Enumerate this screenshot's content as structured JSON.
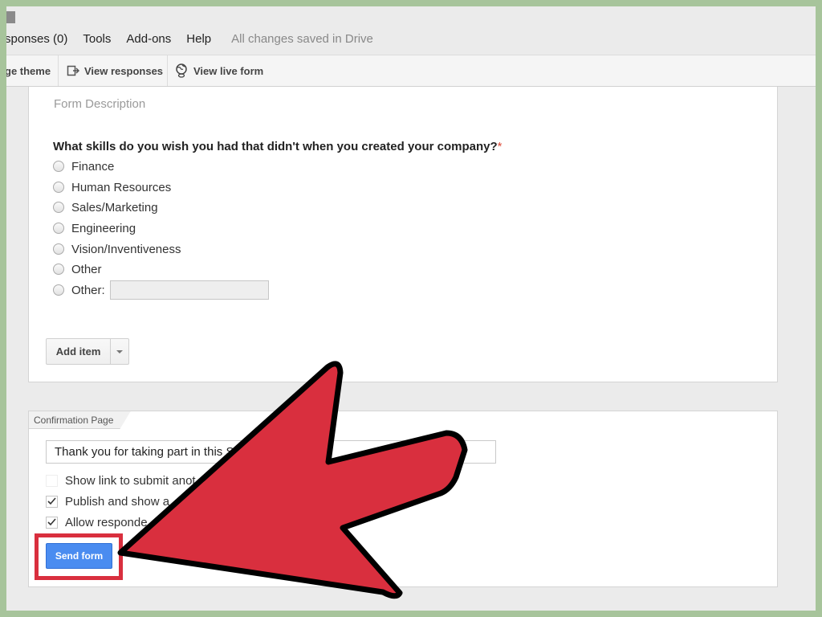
{
  "menubar": {
    "responses": "sponses (0)",
    "tools": "Tools",
    "addons": "Add-ons",
    "help": "Help",
    "save_status": "All changes saved in Drive"
  },
  "toolbar": {
    "change_theme": "ge theme",
    "view_responses": "View responses",
    "view_live_form": "View live form"
  },
  "form": {
    "description_placeholder": "Form Description",
    "question": "What skills do you wish you had that didn't when you created your company?",
    "required_marker": "*",
    "options": [
      "Finance",
      "Human Resources",
      "Sales/Marketing",
      "Engineering",
      "Vision/Inventiveness",
      "Other",
      "Other:"
    ],
    "add_item": "Add item"
  },
  "confirmation": {
    "tab_label": "Confirmation Page",
    "message": "Thank you for taking part in this S",
    "checkboxes": [
      {
        "label": "Show link to submit anot",
        "checked": false
      },
      {
        "label": "Publish and show a",
        "checked": true
      },
      {
        "label": "Allow responde",
        "checked": true
      }
    ],
    "send_form": "Send form"
  },
  "colors": {
    "send_button": "#4a8cf0",
    "highlight_box": "#d92f3e",
    "arrow_fill": "#d92f3e",
    "outer_border": "#a7c49b"
  },
  "icons": {
    "view_responses": "external-sheet-icon",
    "view_live_form": "globe-link-icon",
    "add_item_caret": "caret-down-icon",
    "pointer": "red-arrow-pointer"
  }
}
